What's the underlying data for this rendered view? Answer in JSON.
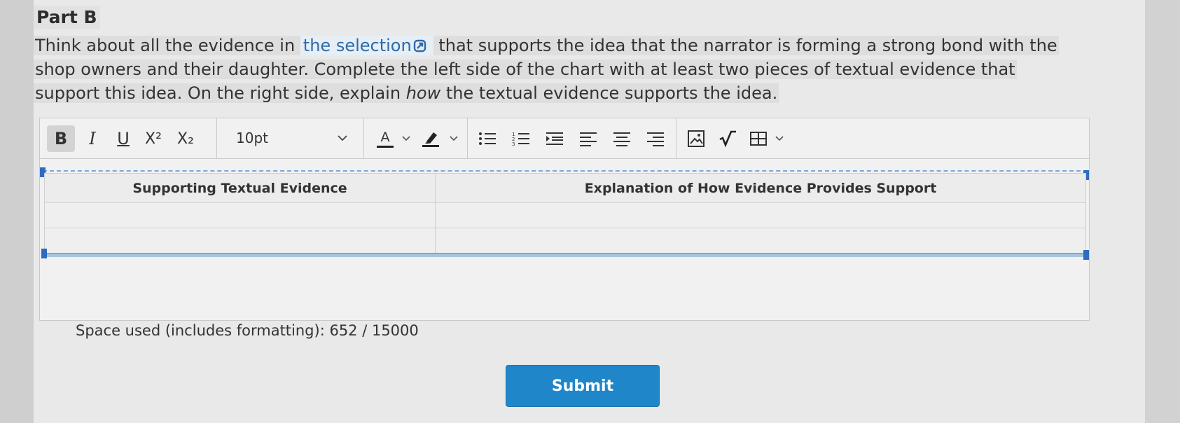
{
  "part_title": "Part B",
  "prompt": {
    "line1_before_link": "Think about all the evidence in",
    "link_text": "the selection",
    "line1_after_link": "that supports the idea that the narrator is forming a strong bond with the",
    "line2": "shop owners and their daughter. Complete the left side of the chart with at least two pieces of textual evidence that",
    "line3_before_em": "support this idea. On the right side, explain",
    "line3_em": "how",
    "line3_after_em": "the textual evidence supports the idea."
  },
  "toolbar": {
    "bold": "B",
    "italic": "I",
    "underline": "U",
    "superscript": "X²",
    "subscript": "X₂",
    "font_size": "10pt",
    "font_color_letter": "A",
    "icons": [
      "bold-icon",
      "italic-icon",
      "underline-icon",
      "superscript-icon",
      "subscript-icon",
      "chevron-down-icon",
      "font-color-icon",
      "highlighter-icon",
      "bulleted-list-icon",
      "numbered-list-icon",
      "indent-icon",
      "align-left-icon",
      "align-center-icon",
      "align-right-icon",
      "image-icon",
      "math-icon",
      "table-icon"
    ]
  },
  "table": {
    "headers": [
      "Supporting Textual Evidence",
      "Explanation of How Evidence Provides Support"
    ],
    "rows": [
      [
        "",
        ""
      ],
      [
        "",
        ""
      ]
    ]
  },
  "space_used": "Space used (includes formatting): 652 / 15000",
  "submit_label": "Submit",
  "colors": {
    "link": "#2f6aa8",
    "submit": "#1f86c9",
    "selection_handle": "#2f6bc0"
  }
}
